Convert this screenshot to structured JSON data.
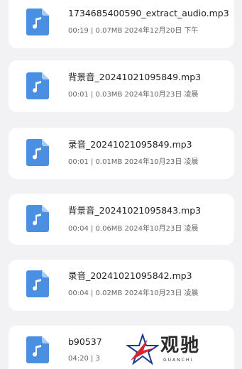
{
  "files": [
    {
      "name": "1734685400590_extract_audio.mp3",
      "meta": "00:19 | 0.07MB  2024年12月20日 下午",
      "icon": "audio-file-icon"
    },
    {
      "name": "背景音_20241021095849.mp3",
      "meta": "00:01 | 0.03MB  2024年10月23日 凌晨",
      "icon": "audio-file-icon"
    },
    {
      "name": "录音_20241021095849.mp3",
      "meta": "00:01 | 0.01MB  2024年10月23日 凌晨",
      "icon": "audio-file-icon"
    },
    {
      "name": "背景音_20241021095843.mp3",
      "meta": "00:04 | 0.06MB  2024年10月23日 凌晨",
      "icon": "audio-file-icon"
    },
    {
      "name": "录音_20241021095842.mp3",
      "meta": "00:04 | 0.02MB  2024年10月23日 凌晨",
      "icon": "audio-file-icon"
    },
    {
      "name": "b90537",
      "meta": "04:20 | 3",
      "icon": "audio-file-icon"
    }
  ],
  "watermark": {
    "text": "观驰",
    "sub": "GUANCHI"
  },
  "colors": {
    "icon_blue": "#4a90e2",
    "icon_fold": "#a9ccf5",
    "background": "#f2f2f4",
    "card": "#ffffff"
  }
}
